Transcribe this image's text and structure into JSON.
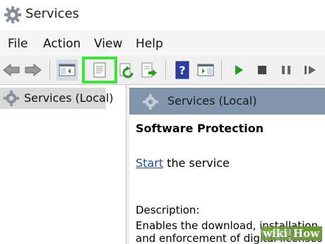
{
  "window": {
    "title": "Services",
    "icon": "gear-icon"
  },
  "menu": {
    "items": [
      "File",
      "Action",
      "View",
      "Help"
    ]
  },
  "toolbar": {
    "buttons": [
      "back-arrow-icon",
      "forward-arrow-icon",
      "show-hide-console-tree-icon",
      "properties-icon",
      "refresh-icon",
      "export-list-icon",
      "help-icon",
      "show-hide-action-pane-icon",
      "start-service-icon",
      "stop-service-icon",
      "pause-service-icon",
      "resume-service-icon"
    ],
    "highlight_color": "#3ee33a"
  },
  "tree": {
    "selected_label": "Services (Local)"
  },
  "detail": {
    "header": "Services (Local)",
    "service_name": "Software Protection",
    "start_link": "Start",
    "start_suffix": " the service",
    "description_label": "Description:",
    "description_line1": "Enables the download, installation",
    "description_line2": "and enforcement of digital licenses"
  },
  "watermark": {
    "wiki": "wiki",
    "how": "How"
  },
  "colors": {
    "header_bg": "#8195ad",
    "link": "#1a4fa8",
    "play_green": "#1aa31a"
  }
}
